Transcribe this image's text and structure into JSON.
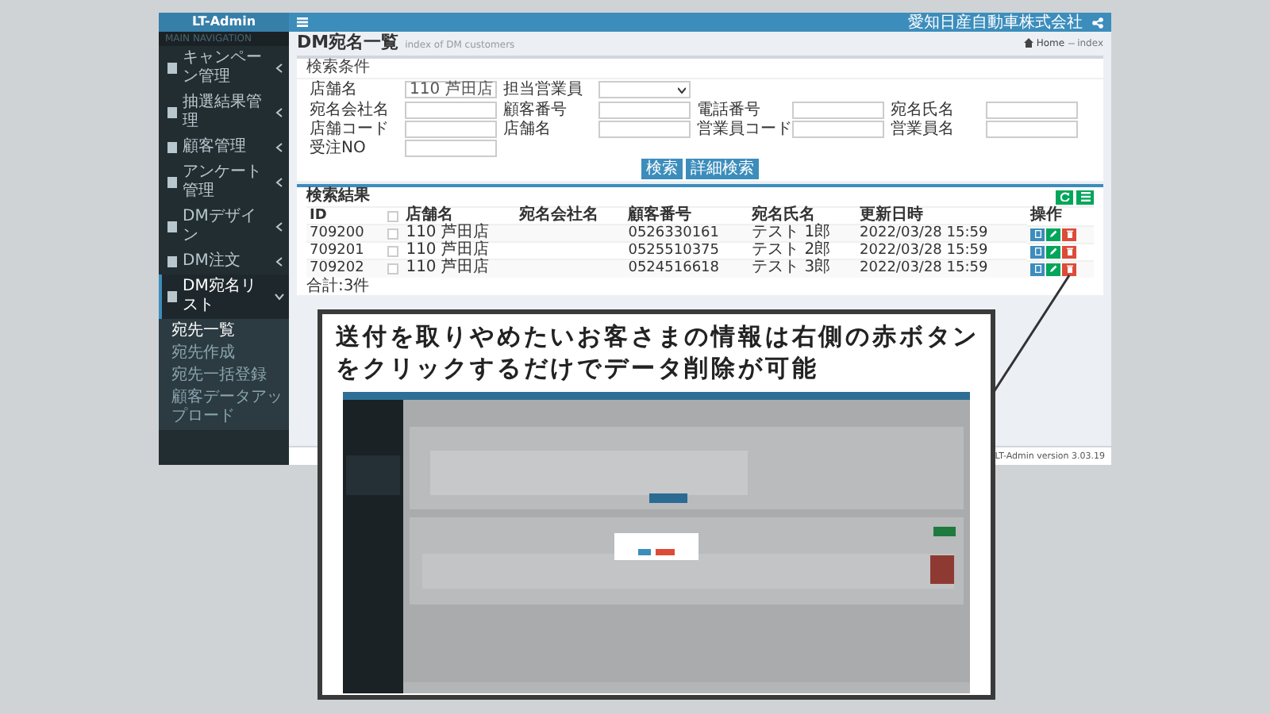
{
  "app": {
    "logo": "LT-Admin",
    "company": "愛知日産自動車株式会社",
    "version": "LT-Admin version 3.03.19"
  },
  "sidebar": {
    "heading": "MAIN NAVIGATION",
    "items": [
      {
        "label": "キャンペーン管理",
        "expanded": false,
        "selected": false
      },
      {
        "label": "抽選結果管理",
        "expanded": false,
        "selected": false
      },
      {
        "label": "顧客管理",
        "expanded": false,
        "selected": false
      },
      {
        "label": "アンケート管理",
        "expanded": false,
        "selected": false
      },
      {
        "label": "DMデザイン",
        "expanded": false,
        "selected": false
      },
      {
        "label": "DM注文",
        "expanded": false,
        "selected": false
      },
      {
        "label": "DM宛名リスト",
        "expanded": true,
        "selected": true,
        "children": [
          {
            "label": "宛先一覧",
            "selected": true
          },
          {
            "label": "宛先作成",
            "selected": false
          },
          {
            "label": "宛先一括登録",
            "selected": false
          },
          {
            "label": "顧客データアップロード",
            "selected": false
          }
        ]
      }
    ]
  },
  "page": {
    "title": "DM宛名一覧",
    "subtitle": "index of DM customers",
    "breadcrumb": [
      "Home",
      "index"
    ]
  },
  "search": {
    "title": "検索条件",
    "fields": [
      {
        "kind": "select",
        "label": "店舗名",
        "value": "110 芦田店"
      },
      {
        "kind": "select",
        "label": "担当営業員"
      },
      {
        "kind": "break"
      },
      {
        "kind": "text",
        "label": "宛名会社名"
      },
      {
        "kind": "text",
        "label": "顧客番号"
      },
      {
        "kind": "text",
        "label": "電話番号"
      },
      {
        "kind": "text",
        "label": "宛名氏名"
      },
      {
        "kind": "text",
        "label": "店舗コード"
      },
      {
        "kind": "text",
        "label": "店舗名"
      },
      {
        "kind": "text",
        "label": "営業員コード"
      },
      {
        "kind": "text",
        "label": "営業員名"
      },
      {
        "kind": "text",
        "label": "受注NO"
      }
    ],
    "buttons": [
      "検索",
      "詳細検索"
    ]
  },
  "results": {
    "title": "検索結果",
    "columns": [
      "ID",
      "店舗名",
      "宛名会社名",
      "顧客番号",
      "宛名氏名",
      "更新日時",
      "操作"
    ],
    "select_all_checked": false,
    "rows": [
      {
        "checked": false,
        "cells": [
          "709200",
          "110 芦田店",
          "",
          "0526330161",
          "テスト 1郎",
          "2022/03/28 15:59"
        ]
      },
      {
        "checked": false,
        "cells": [
          "709201",
          "110 芦田店",
          "",
          "0525510375",
          "テスト 2郎",
          "2022/03/28 15:59"
        ]
      },
      {
        "checked": false,
        "cells": [
          "709202",
          "110 芦田店",
          "",
          "0524516618",
          "テスト 3郎",
          "2022/03/28 15:59"
        ]
      }
    ],
    "total": "合計:3件"
  },
  "callout": {
    "text": "送付を取りやめたいお客さまの情報は右側の赤ボタンをクリックするだけでデータ削除が可能"
  }
}
